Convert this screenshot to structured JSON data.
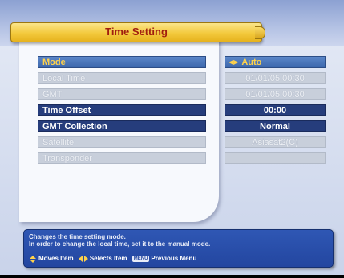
{
  "title": "Time Setting",
  "rows": [
    {
      "label": "Mode",
      "value": "Auto",
      "state": "focus"
    },
    {
      "label": "Local Time",
      "value": "01/01/05 00:30",
      "state": "disabled"
    },
    {
      "label": "GMT",
      "value": "01/01/05 00:30",
      "state": "disabled"
    },
    {
      "label": "Time Offset",
      "value": "00:00",
      "state": "active"
    },
    {
      "label": "GMT Collection",
      "value": "Normal",
      "state": "active"
    },
    {
      "label": "Satellite",
      "value": "Asiasat2(C)",
      "state": "disabled"
    },
    {
      "label": "Transponder",
      "value": "",
      "state": "disabled"
    }
  ],
  "info": {
    "line1": "Changes the time setting mode.",
    "line2": "In order to change the local time, set it to the manual mode."
  },
  "help": {
    "move": "Moves Item",
    "select": "Selects Item",
    "menu_key": "MENU",
    "previous": "Previous Menu"
  },
  "icons": {
    "mode_arrows": "left-right-arrows-icon",
    "move_key": "up-down-key-icon",
    "select_key": "left-right-key-icon",
    "menu_key": "menu-key-icon"
  },
  "colors": {
    "focus_bg": "#4a75ba",
    "focus_text": "#ffd24a",
    "active_bg": "#263d7c",
    "disabled_bg": "#c8cfdb",
    "title_bg": "#f3c93d",
    "title_text": "#a11d0f",
    "info_bg": "#2a4fab"
  }
}
